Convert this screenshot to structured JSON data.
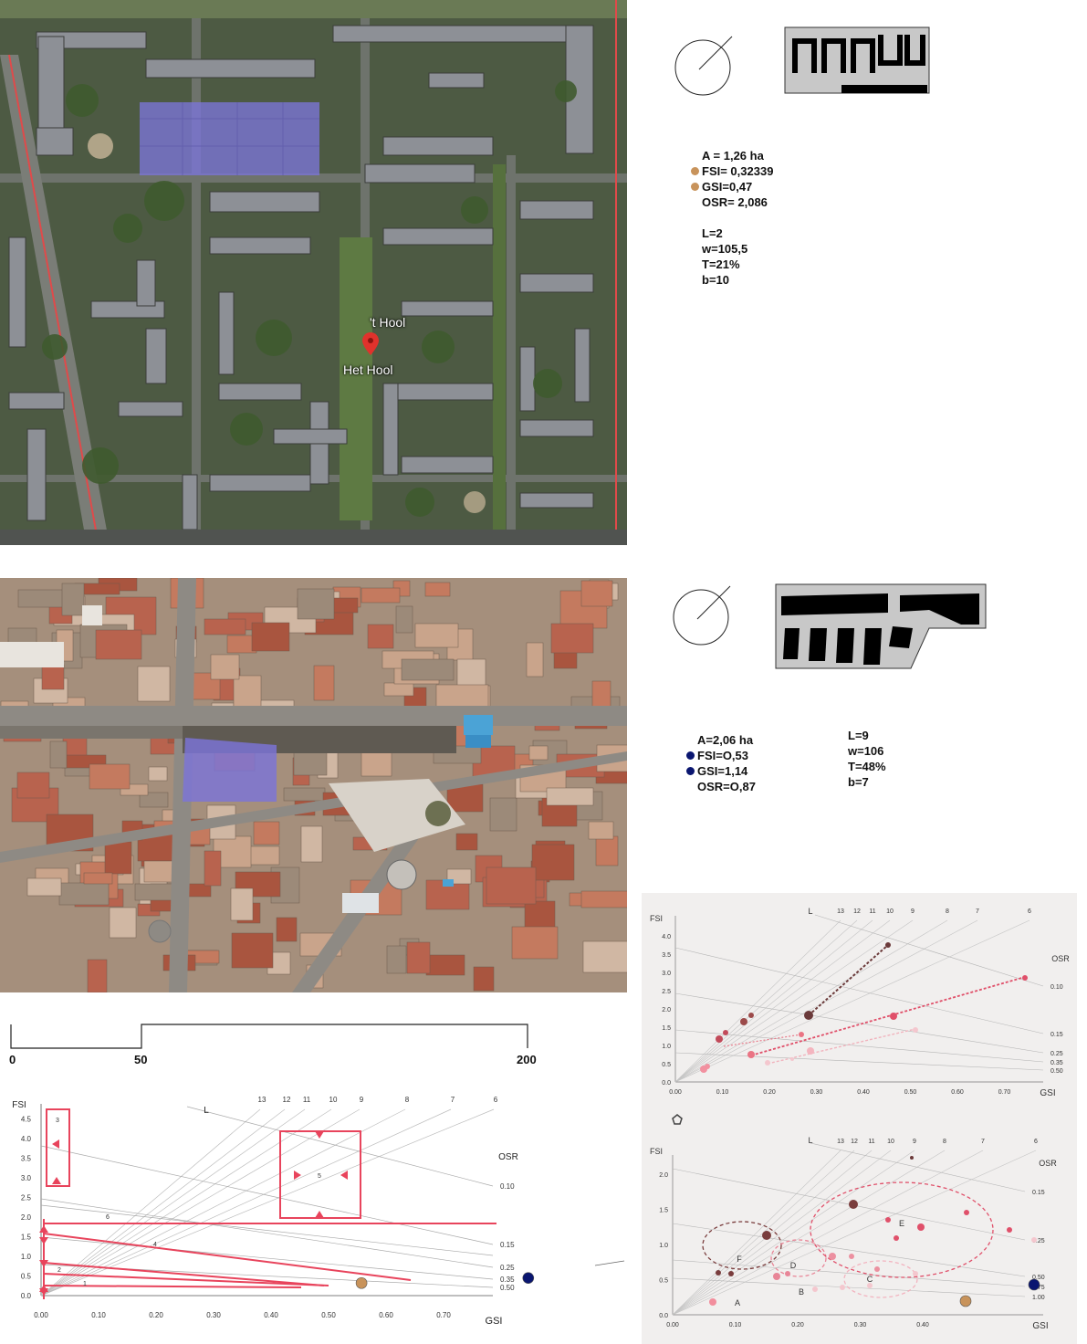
{
  "site1": {
    "pin_label_top": "'t Hool",
    "pin_label_bottom": "Het Hool",
    "stats": [
      {
        "text": "A  =  1,26 ha",
        "marker": ""
      },
      {
        "text": "FSI=  0,32339",
        "marker": "#c8935b"
      },
      {
        "text": "GSI=0,47",
        "marker": "#c8935b"
      },
      {
        "text": "OSR=  2,086",
        "marker": ""
      },
      {
        "text": "",
        "marker": ""
      },
      {
        "text": "L=2",
        "marker": ""
      },
      {
        "text": "w=105,5",
        "marker": ""
      },
      {
        "text": "T=21%",
        "marker": ""
      },
      {
        "text": "b=10",
        "marker": ""
      }
    ],
    "overlay_color": "#7b74d8"
  },
  "site2": {
    "stats_left": [
      {
        "text": "A=2,06 ha",
        "marker": ""
      },
      {
        "text": "FSI=O,53",
        "marker": "#0a1670"
      },
      {
        "text": "GSI=1,14",
        "marker": "#0a1670"
      },
      {
        "text": "OSR=O,87",
        "marker": ""
      }
    ],
    "stats_right": [
      {
        "text": "L=9"
      },
      {
        "text": "w=106"
      },
      {
        "text": "T=48%"
      },
      {
        "text": "b=7"
      }
    ],
    "overlay_color": "#7b74d8"
  },
  "scale_bar": {
    "labels": [
      "0",
      "50",
      "200"
    ]
  },
  "charts": {
    "main": {
      "type": "scatter",
      "ylabel": "FSI",
      "xlabel": "GSI",
      "l_label": "L",
      "osr_label": "OSR",
      "xticks": [
        "0.00",
        "0.10",
        "0.20",
        "0.30",
        "0.40",
        "0.50",
        "0.60",
        "0.70"
      ],
      "yticks": [
        "0.0",
        "0.5",
        "1.0",
        "1.5",
        "2.0",
        "2.5",
        "3.0",
        "3.5",
        "4.0",
        "4.5"
      ],
      "l_values": [
        "13",
        "12",
        "11",
        "10",
        "9",
        "8",
        "7",
        "6"
      ],
      "osr_values": [
        "0.10",
        "0.15",
        "0.25",
        "0.35",
        "0.50"
      ],
      "zone_labels": [
        "1",
        "2",
        "3",
        "4",
        "5",
        "6"
      ],
      "points": [
        {
          "gsi": 0.47,
          "fsi": 0.32,
          "color": "#c8935b"
        },
        {
          "gsi": 0.76,
          "fsi": 0.45,
          "color": "#0a1670"
        }
      ]
    },
    "top_right": {
      "ylabel": "FSI",
      "xlabel": "GSI",
      "l_label": "L",
      "osr_label": "OSR",
      "xticks": [
        "0.00",
        "0.10",
        "0.20",
        "0.30",
        "0.40",
        "0.50",
        "0.60",
        "0.70"
      ],
      "yticks": [
        "0.0",
        "0.5",
        "1.0",
        "1.5",
        "2.0",
        "2.5",
        "3.0",
        "3.5",
        "4.0"
      ],
      "l_values": [
        "13",
        "12",
        "11",
        "10",
        "9",
        "8",
        "7",
        "6"
      ],
      "osr_values": [
        "0.10",
        "0.15",
        "0.25",
        "0.35",
        "0.50"
      ]
    },
    "bottom_right": {
      "ylabel": "FSI",
      "xlabel": "GSI",
      "l_label": "L",
      "osr_label": "OSR",
      "xticks": [
        "0.00",
        "0.10",
        "0.20",
        "0.30",
        "0.40"
      ],
      "yticks": [
        "0.0",
        "0.5",
        "1.0",
        "1.5",
        "2.0"
      ],
      "l_values": [
        "13",
        "12",
        "11",
        "10",
        "9",
        "8",
        "7",
        "6"
      ],
      "osr_values": [
        "0.15",
        "0.25",
        "0.50",
        "0.75",
        "1.00"
      ],
      "cluster_labels": [
        "A",
        "B",
        "C",
        "D",
        "E",
        "F"
      ],
      "points": [
        {
          "gsi": 0.47,
          "fsi": 0.3,
          "color": "#c8935b"
        },
        {
          "gsi": 0.58,
          "fsi": 0.62,
          "color": "#0a1670"
        }
      ]
    }
  }
}
